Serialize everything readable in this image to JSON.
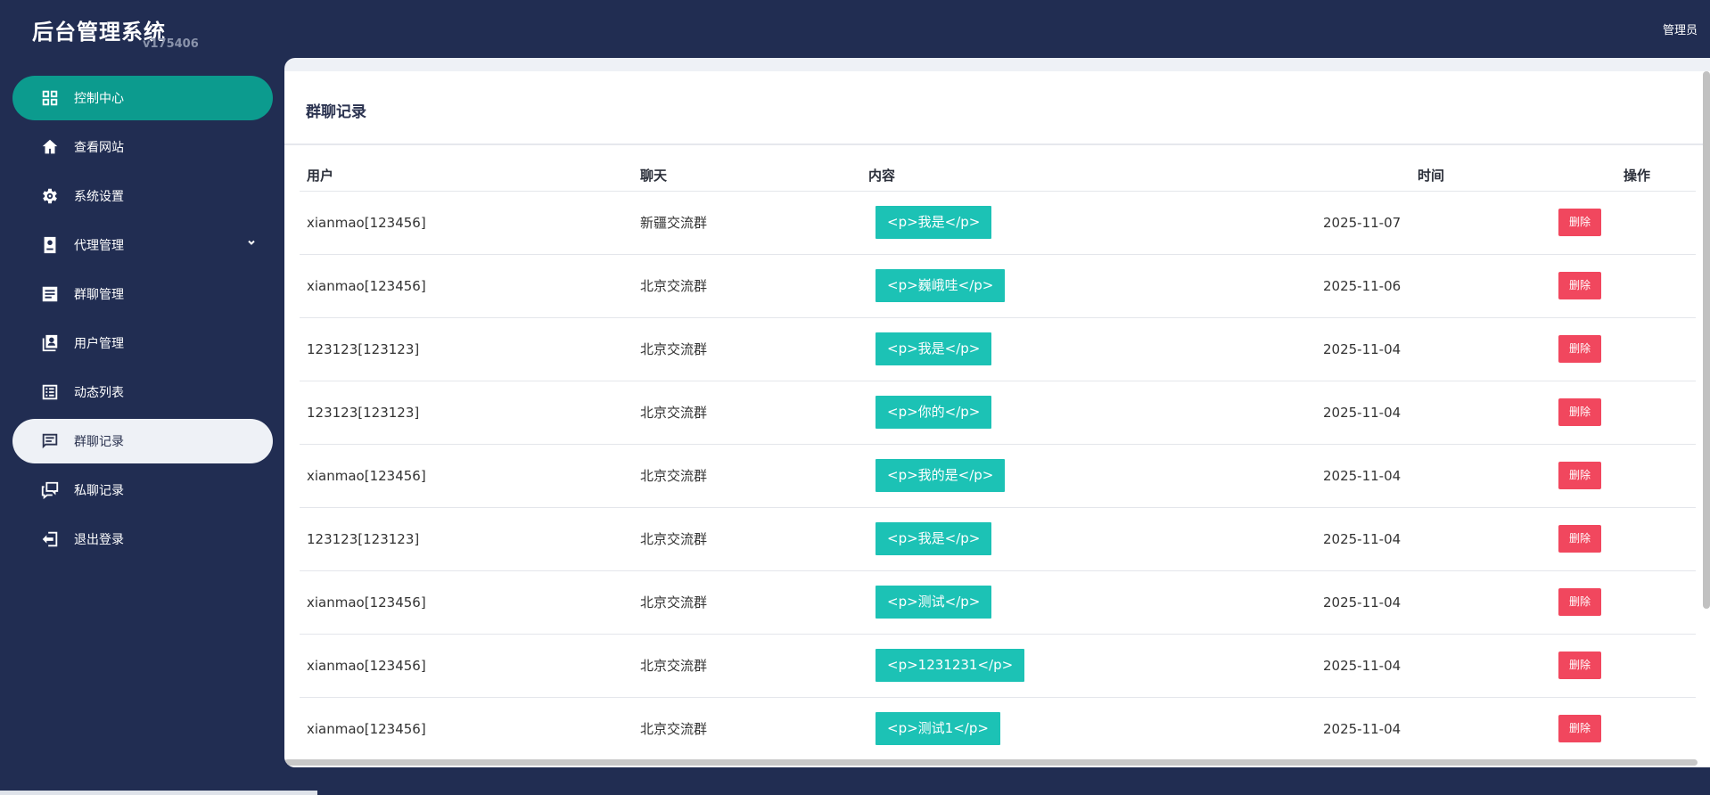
{
  "app": {
    "title": "后台管理系统",
    "version": "v175406",
    "user": "管理员"
  },
  "sidebar": {
    "items": [
      {
        "label": "控制中心",
        "icon": "dashboard-icon"
      },
      {
        "label": "查看网站",
        "icon": "home-icon"
      },
      {
        "label": "系统设置",
        "icon": "gear-icon"
      },
      {
        "label": "代理管理",
        "icon": "agent-icon"
      },
      {
        "label": "群聊管理",
        "icon": "group-chat-icon"
      },
      {
        "label": "用户管理",
        "icon": "user-icon"
      },
      {
        "label": "动态列表",
        "icon": "list-icon"
      },
      {
        "label": "群聊记录",
        "icon": "chat-icon"
      },
      {
        "label": "私聊记录",
        "icon": "private-chat-icon"
      },
      {
        "label": "退出登录",
        "icon": "logout-icon"
      }
    ]
  },
  "page": {
    "title": "群聊记录",
    "columns": {
      "user": "用户",
      "chat": "聊天",
      "content": "内容",
      "time": "时间",
      "action": "操作"
    },
    "delete_label": "删除",
    "rows": [
      {
        "user": "xianmao[123456]",
        "chat": "新疆交流群",
        "content": "<p>我是</p>",
        "time": "2025-11-07"
      },
      {
        "user": "xianmao[123456]",
        "chat": "北京交流群",
        "content": "<p>巍峨哇</p>",
        "time": "2025-11-06"
      },
      {
        "user": "123123[123123]",
        "chat": "北京交流群",
        "content": "<p>我是</p>",
        "time": "2025-11-04"
      },
      {
        "user": "123123[123123]",
        "chat": "北京交流群",
        "content": "<p>你的</p>",
        "time": "2025-11-04"
      },
      {
        "user": "xianmao[123456]",
        "chat": "北京交流群",
        "content": "<p>我的是</p>",
        "time": "2025-11-04"
      },
      {
        "user": "123123[123123]",
        "chat": "北京交流群",
        "content": "<p>我是</p>",
        "time": "2025-11-04"
      },
      {
        "user": "xianmao[123456]",
        "chat": "北京交流群",
        "content": "<p>测试</p>",
        "time": "2025-11-04"
      },
      {
        "user": "xianmao[123456]",
        "chat": "北京交流群",
        "content": "<p>1231231</p>",
        "time": "2025-11-04"
      },
      {
        "user": "xianmao[123456]",
        "chat": "北京交流群",
        "content": "<p>测试1</p>",
        "time": "2025-11-04"
      }
    ]
  },
  "colors": {
    "sidebar_bg": "#212d52",
    "active_green": "#0c9b8e",
    "tag_teal": "#1cc2b5",
    "delete_red": "#f1475e"
  }
}
